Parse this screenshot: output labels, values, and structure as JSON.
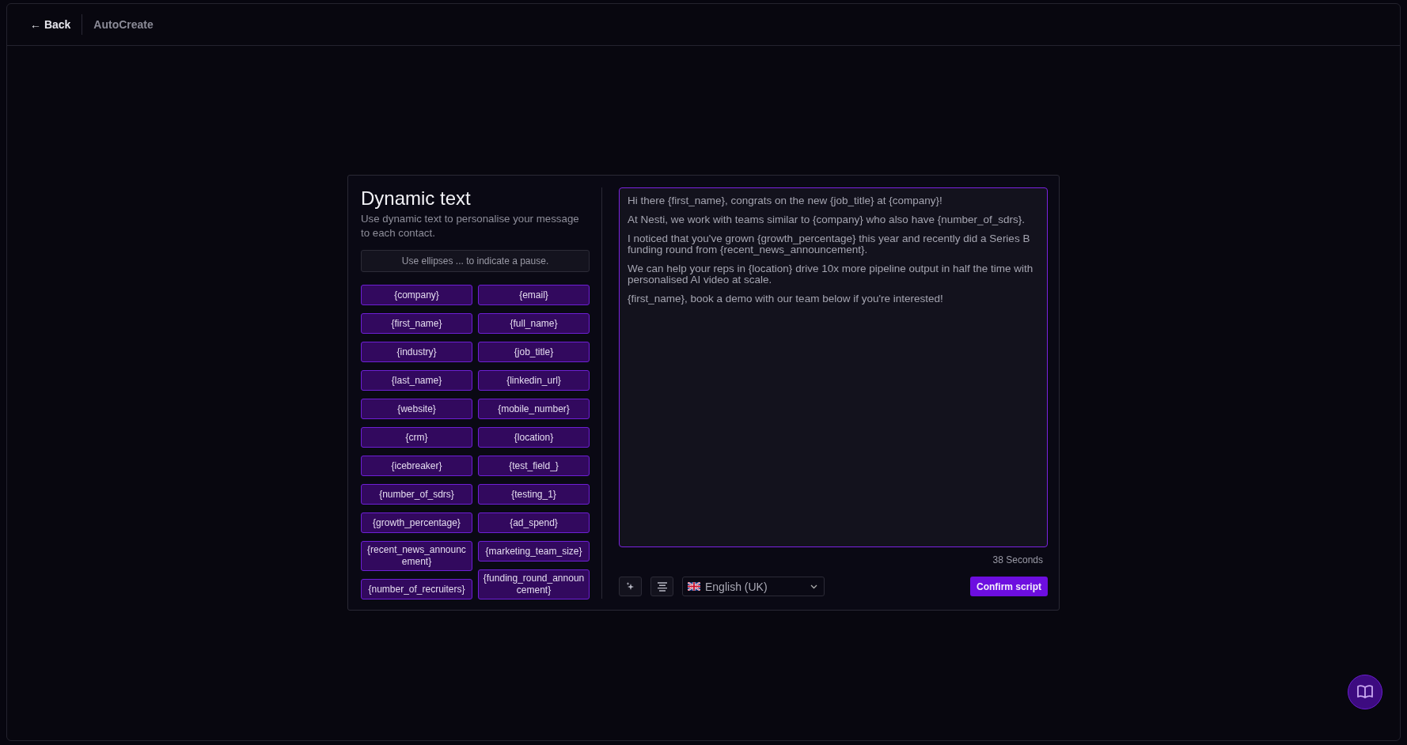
{
  "header": {
    "back": "← Back",
    "title": "AutoCreate"
  },
  "panel": {
    "title": "Dynamic text",
    "description": "Use dynamic text to personalise your message to each contact.",
    "hint": "Use ellipses ... to indicate a pause.",
    "variable_columns": [
      [
        "{company}",
        "{first_name}",
        "{industry}",
        "{last_name}",
        "{website}",
        "{crm}",
        "{icebreaker}",
        "{number_of_sdrs}",
        "{growth_percentage}",
        "{recent_news_announcement}",
        "{number_of_recruiters}"
      ],
      [
        "{email}",
        "{full_name}",
        "{job_title}",
        "{linkedin_url}",
        "{mobile_number}",
        "{location}",
        "{test_field_}",
        "{testing_1}",
        "{ad_spend}",
        "{marketing_team_size}",
        "{funding_round_announcement}"
      ]
    ]
  },
  "editor": {
    "paragraphs": [
      "Hi there {first_name}, congrats on the new {job_title} at {company}!",
      "At Nesti, we work with teams similar to {company} who also have {number_of_sdrs}.",
      "I noticed that you've grown {growth_percentage} this year and recently did a Series B funding round from {recent_news_announcement}.",
      "We can help your reps in {location} drive 10x more pipeline output in half the time with personalised AI video at scale.",
      "{first_name}, book a demo with our team below if you're interested!"
    ],
    "duration": "38 Seconds",
    "language": "English (UK)",
    "confirm": "Confirm script"
  }
}
